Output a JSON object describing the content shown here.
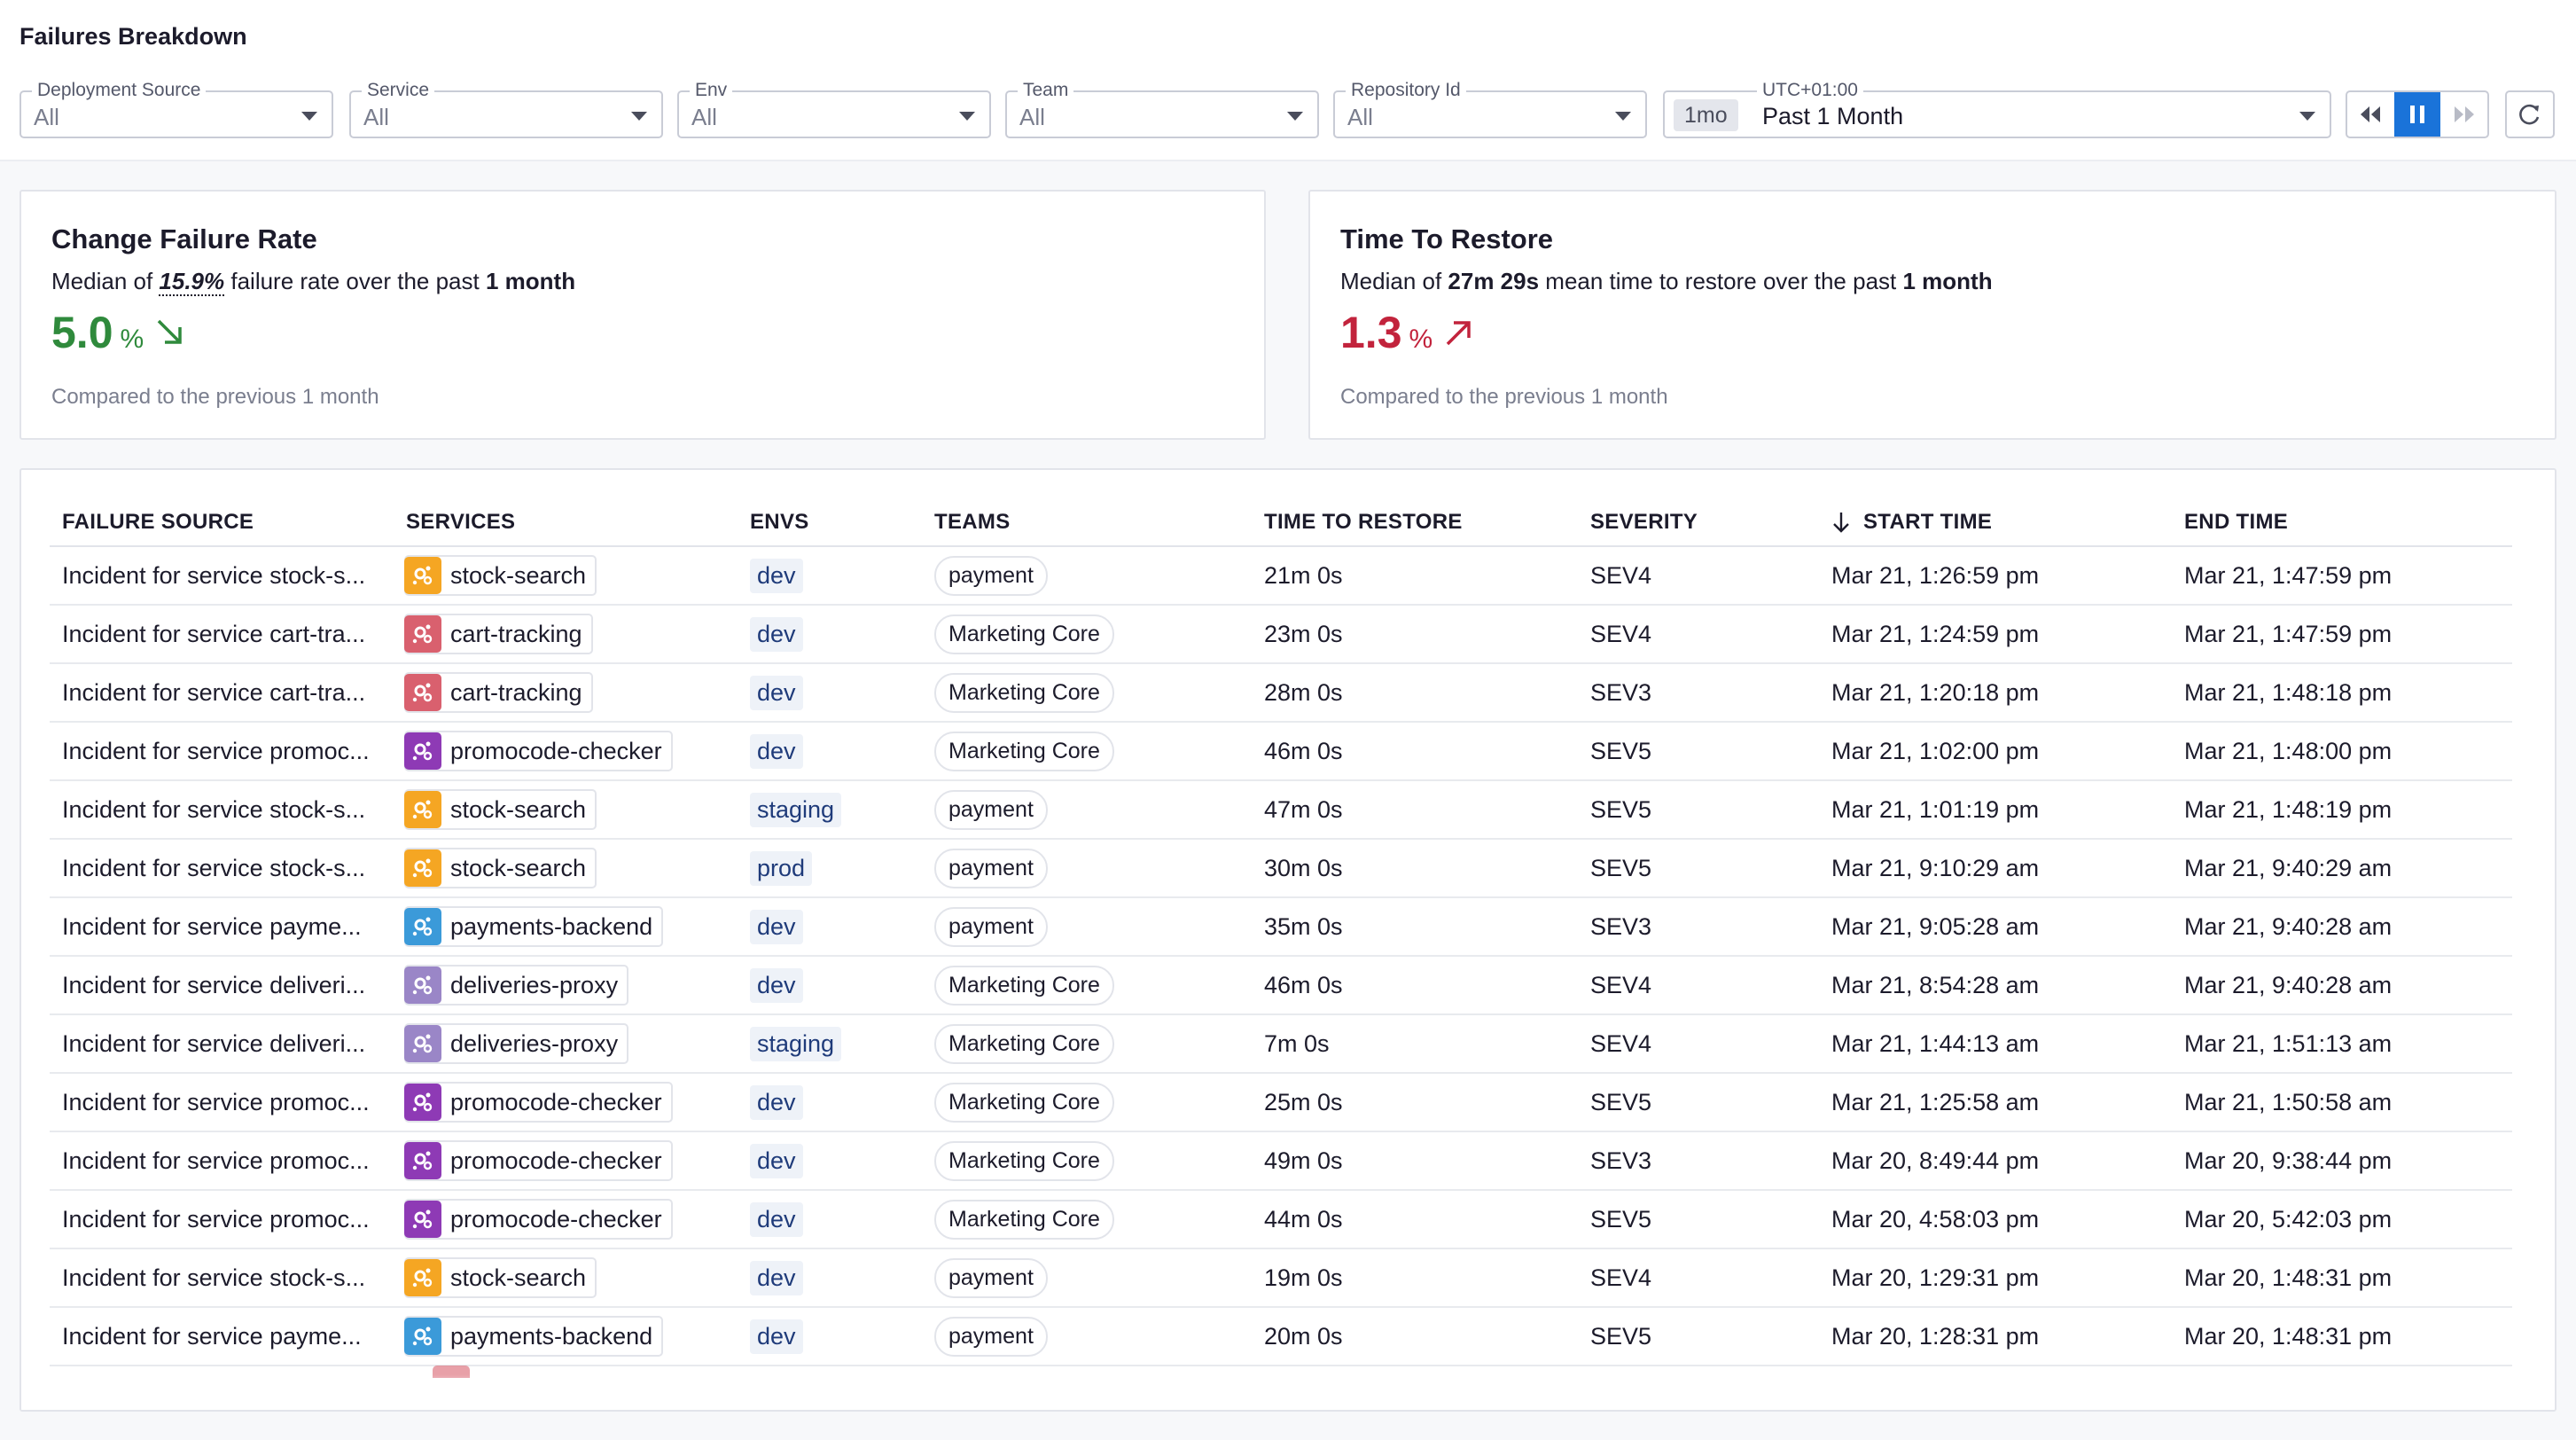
{
  "page": {
    "title": "Failures Breakdown"
  },
  "filters": [
    {
      "label": "Deployment Source",
      "value": "All"
    },
    {
      "label": "Service",
      "value": "All"
    },
    {
      "label": "Env",
      "value": "All"
    },
    {
      "label": "Team",
      "value": "All"
    },
    {
      "label": "Repository Id",
      "value": "All"
    }
  ],
  "time": {
    "timezone": "UTC+01:00",
    "pill": "1mo",
    "value": "Past 1 Month"
  },
  "controls": {
    "rewind": "rewind-icon",
    "pause": "pause-icon",
    "forward": "fast-forward-icon",
    "refresh": "refresh-icon"
  },
  "cards": {
    "cfr": {
      "title": "Change Failure Rate",
      "sub_prefix": "Median of ",
      "sub_value": "15.9%",
      "sub_mid": " failure rate over the past ",
      "sub_period": "1 month",
      "value": "5.0",
      "unit": "%",
      "trend": "down",
      "footer": "Compared to the previous 1 month",
      "color": "#2f8a3c"
    },
    "ttr": {
      "title": "Time To Restore",
      "sub_prefix": "Median of ",
      "sub_value": "27m 29s",
      "sub_mid": " mean time to restore over the past ",
      "sub_period": "1 month",
      "value": "1.3",
      "unit": "%",
      "trend": "up",
      "footer": "Compared to the previous 1 month",
      "color": "#c2233c"
    }
  },
  "table": {
    "columns": [
      "FAILURE SOURCE",
      "SERVICES",
      "ENVS",
      "TEAMS",
      "TIME TO RESTORE",
      "SEVERITY",
      "START TIME",
      "END TIME"
    ],
    "service_colors": {
      "stock-search": "#f5a623",
      "cart-tracking": "#d9606e",
      "promocode-checker": "#8e3ab5",
      "payments-backend": "#3b9ad9",
      "deliveries-proxy": "#9a86c7"
    },
    "rows": [
      {
        "source": "Incident for service stock-s...",
        "service": "stock-search",
        "env": "dev",
        "team": "payment",
        "ttr": "21m 0s",
        "severity": "SEV4",
        "start": "Mar 21, 1:26:59 pm",
        "end": "Mar 21, 1:47:59 pm"
      },
      {
        "source": "Incident for service cart-tra...",
        "service": "cart-tracking",
        "env": "dev",
        "team": "Marketing Core",
        "ttr": "23m 0s",
        "severity": "SEV4",
        "start": "Mar 21, 1:24:59 pm",
        "end": "Mar 21, 1:47:59 pm"
      },
      {
        "source": "Incident for service cart-tra...",
        "service": "cart-tracking",
        "env": "dev",
        "team": "Marketing Core",
        "ttr": "28m 0s",
        "severity": "SEV3",
        "start": "Mar 21, 1:20:18 pm",
        "end": "Mar 21, 1:48:18 pm"
      },
      {
        "source": "Incident for service promoc...",
        "service": "promocode-checker",
        "env": "dev",
        "team": "Marketing Core",
        "ttr": "46m 0s",
        "severity": "SEV5",
        "start": "Mar 21, 1:02:00 pm",
        "end": "Mar 21, 1:48:00 pm"
      },
      {
        "source": "Incident for service stock-s...",
        "service": "stock-search",
        "env": "staging",
        "team": "payment",
        "ttr": "47m 0s",
        "severity": "SEV5",
        "start": "Mar 21, 1:01:19 pm",
        "end": "Mar 21, 1:48:19 pm"
      },
      {
        "source": "Incident for service stock-s...",
        "service": "stock-search",
        "env": "prod",
        "team": "payment",
        "ttr": "30m 0s",
        "severity": "SEV5",
        "start": "Mar 21, 9:10:29 am",
        "end": "Mar 21, 9:40:29 am"
      },
      {
        "source": "Incident for service payme...",
        "service": "payments-backend",
        "env": "dev",
        "team": "payment",
        "ttr": "35m 0s",
        "severity": "SEV3",
        "start": "Mar 21, 9:05:28 am",
        "end": "Mar 21, 9:40:28 am"
      },
      {
        "source": "Incident for service deliveri...",
        "service": "deliveries-proxy",
        "env": "dev",
        "team": "Marketing Core",
        "ttr": "46m 0s",
        "severity": "SEV4",
        "start": "Mar 21, 8:54:28 am",
        "end": "Mar 21, 9:40:28 am"
      },
      {
        "source": "Incident for service deliveri...",
        "service": "deliveries-proxy",
        "env": "staging",
        "team": "Marketing Core",
        "ttr": "7m 0s",
        "severity": "SEV4",
        "start": "Mar 21, 1:44:13 am",
        "end": "Mar 21, 1:51:13 am"
      },
      {
        "source": "Incident for service promoc...",
        "service": "promocode-checker",
        "env": "dev",
        "team": "Marketing Core",
        "ttr": "25m 0s",
        "severity": "SEV5",
        "start": "Mar 21, 1:25:58 am",
        "end": "Mar 21, 1:50:58 am"
      },
      {
        "source": "Incident for service promoc...",
        "service": "promocode-checker",
        "env": "dev",
        "team": "Marketing Core",
        "ttr": "49m 0s",
        "severity": "SEV3",
        "start": "Mar 20, 8:49:44 pm",
        "end": "Mar 20, 9:38:44 pm"
      },
      {
        "source": "Incident for service promoc...",
        "service": "promocode-checker",
        "env": "dev",
        "team": "Marketing Core",
        "ttr": "44m 0s",
        "severity": "SEV5",
        "start": "Mar 20, 4:58:03 pm",
        "end": "Mar 20, 5:42:03 pm"
      },
      {
        "source": "Incident for service stock-s...",
        "service": "stock-search",
        "env": "dev",
        "team": "payment",
        "ttr": "19m 0s",
        "severity": "SEV4",
        "start": "Mar 20, 1:29:31 pm",
        "end": "Mar 20, 1:48:31 pm"
      },
      {
        "source": "Incident for service payme...",
        "service": "payments-backend",
        "env": "dev",
        "team": "payment",
        "ttr": "20m 0s",
        "severity": "SEV5",
        "start": "Mar 20, 1:28:31 pm",
        "end": "Mar 20, 1:48:31 pm"
      }
    ]
  }
}
